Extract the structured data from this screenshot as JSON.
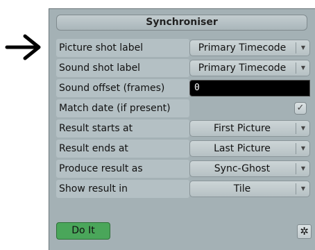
{
  "dialog": {
    "title": "Synchroniser"
  },
  "rows": [
    {
      "label": "Picture shot label",
      "control": "select",
      "value": "Primary Timecode"
    },
    {
      "label": "Sound shot label",
      "control": "select",
      "value": "Primary Timecode"
    },
    {
      "label": "Sound offset (frames)",
      "control": "text",
      "value": "0"
    },
    {
      "label": "Match date (if present)",
      "control": "checkbox",
      "checked": true
    },
    {
      "label": "Result starts at",
      "control": "select",
      "value": "First Picture"
    },
    {
      "label": "Result ends at",
      "control": "select",
      "value": "Last Picture"
    },
    {
      "label": "Produce result as",
      "control": "select",
      "value": "Sync-Ghost"
    },
    {
      "label": "Show result in",
      "control": "select",
      "value": "Tile"
    }
  ],
  "footer": {
    "do_it_label": "Do It"
  },
  "icons": {
    "pointer_arrow": "arrow-right-icon",
    "dropdown": "chevron-down-icon",
    "checkbox_mark": "check-icon",
    "options": "asterisk-icon"
  },
  "colors": {
    "panel_bg": "#a4b1b5",
    "do_it_green": "#4aa65a",
    "input_bg": "#000000"
  }
}
